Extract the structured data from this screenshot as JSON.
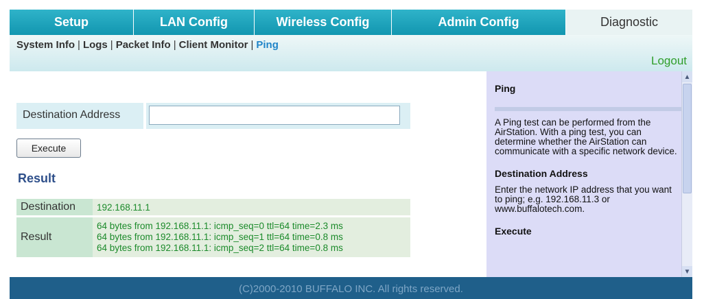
{
  "topnav": {
    "tabs": [
      {
        "label": "Setup"
      },
      {
        "label": "LAN Config"
      },
      {
        "label": "Wireless Config"
      },
      {
        "label": "Admin Config"
      },
      {
        "label": "Diagnostic"
      }
    ]
  },
  "subnav": {
    "links": [
      {
        "label": "System Info"
      },
      {
        "label": "Logs"
      },
      {
        "label": "Packet Info"
      },
      {
        "label": "Client Monitor"
      },
      {
        "label": "Ping"
      }
    ],
    "logout": "Logout"
  },
  "form": {
    "dest_label": "Destination Address",
    "dest_value": "",
    "execute_label": "Execute"
  },
  "result": {
    "title": "Result",
    "destination_label": "Destination",
    "destination_value": "192.168.11.1",
    "result_label": "Result",
    "lines": [
      "64 bytes from 192.168.11.1: icmp_seq=0 ttl=64 time=2.3 ms",
      "64 bytes from 192.168.11.1: icmp_seq=1 ttl=64 time=0.8 ms",
      "64 bytes from 192.168.11.1: icmp_seq=2 ttl=64 time=0.8 ms"
    ]
  },
  "help": {
    "title": "Ping",
    "intro": "A Ping test can be performed from the AirStation. With a ping test, you can determine whether the AirStation can communicate with a specific network device.",
    "dest_heading": "Destination Address",
    "dest_text": "Enter the network IP address that you want to ping; e.g. 192.168.11.3 or www.buffalotech.com.",
    "exec_heading": "Execute"
  },
  "footer": {
    "text": "(C)2000-2010 BUFFALO INC. All rights reserved."
  },
  "colors": {
    "tab_blue": "#1296b0",
    "footer_blue": "#1f5f8a",
    "result_green": "#1b8a2a",
    "help_bg": "#dcdcf7"
  }
}
